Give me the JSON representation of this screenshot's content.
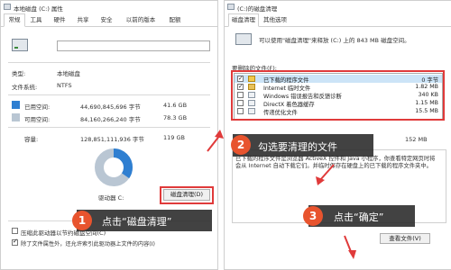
{
  "left_window": {
    "title": "本地磁盘 (C:) 属性",
    "tabs": [
      "常规",
      "工具",
      "硬件",
      "共享",
      "安全",
      "以前的版本",
      "配额"
    ],
    "type_label": "类型:",
    "type_value": "本地磁盘",
    "fs_label": "文件系统:",
    "fs_value": "NTFS",
    "used_label": "已用空间:",
    "used_bytes": "44,690,845,696 字节",
    "used_gb": "41.6 GB",
    "free_label": "可用空间:",
    "free_bytes": "84,160,266,240 字节",
    "free_gb": "78.3 GB",
    "capacity_label": "容量:",
    "capacity_bytes": "128,851,111,936 字节",
    "capacity_gb": "119 GB",
    "drive_label": "驱动器 C:",
    "cleanup_button": "磁盘清理(D)",
    "compress_checkbox": "压缩此驱动器以节约磁盘空间(C)",
    "index_checkbox": "除了文件属性外，还允许索引此驱动器上文件的内容(I)",
    "used_fraction": 0.347,
    "colors": {
      "used": "#2f7fd1",
      "free": "#b9c6d3"
    }
  },
  "right_window": {
    "title": "(C:)的磁盘清理",
    "tabs": [
      "磁盘清理",
      "其他选项"
    ],
    "header_text": "可以使用\"磁盘清理\"来释放 (C:) 上的 843 MB 磁盘空间。",
    "delete_label": "要删除的文件(F):",
    "files": [
      {
        "name": "已下载的程序文件",
        "size": "0 字节",
        "checked": true,
        "selected": true
      },
      {
        "name": "Internet 临时文件",
        "size": "1.82 MB",
        "checked": true,
        "selected": false
      },
      {
        "name": "Windows 错误报告和反馈诊断",
        "size": "340 KB",
        "checked": false,
        "selected": false
      },
      {
        "name": "DirectX 着色器缓存",
        "size": "1.15 MB",
        "checked": false,
        "selected": false
      },
      {
        "name": "传递优化文件",
        "size": "15.5 MB",
        "checked": false,
        "selected": false
      }
    ],
    "space_gain": "152 MB",
    "desc_title": "描述",
    "desc_text": "已下载的程序文件是浏览器 ActiveX 控件和 Java 小程序，你查看特定网页时将会从 Internet 自动下载它们。并临时保存在硬盘上的已下载的程序文件夹中。",
    "view_files_button": "查看文件(V)"
  },
  "callouts": {
    "step1_num": "1",
    "step1_text": "点击“磁盘清理”",
    "step2_num": "2",
    "step2_text": "勾选要清理的文件",
    "step3_num": "3",
    "step3_text": "点击“确定”"
  }
}
